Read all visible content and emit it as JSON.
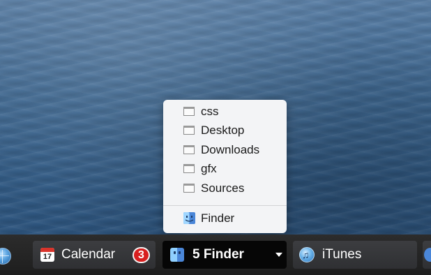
{
  "popup_menu": {
    "items": [
      {
        "label": "css",
        "icon": "window-icon"
      },
      {
        "label": "Desktop",
        "icon": "window-icon"
      },
      {
        "label": "Downloads",
        "icon": "window-icon"
      },
      {
        "label": "gfx",
        "icon": "window-icon"
      },
      {
        "label": "Sources",
        "icon": "window-icon"
      }
    ],
    "app_item": {
      "label": "Finder",
      "icon": "finder-icon"
    }
  },
  "taskbar": {
    "tasks": [
      {
        "label": "Calendar",
        "icon": "calendar-icon",
        "calendar_day": "17",
        "badge": "3"
      },
      {
        "label": "5 Finder",
        "icon": "finder-icon",
        "active": true,
        "dropdown": "chevron-down-icon"
      },
      {
        "label": "iTunes",
        "icon": "itunes-icon"
      }
    ],
    "left_edge_icon": "globe-icon"
  },
  "colors": {
    "badge": "#d81f1f",
    "active_task": "#060606",
    "taskbar": "#262626",
    "popup": "#f3f4f6"
  }
}
